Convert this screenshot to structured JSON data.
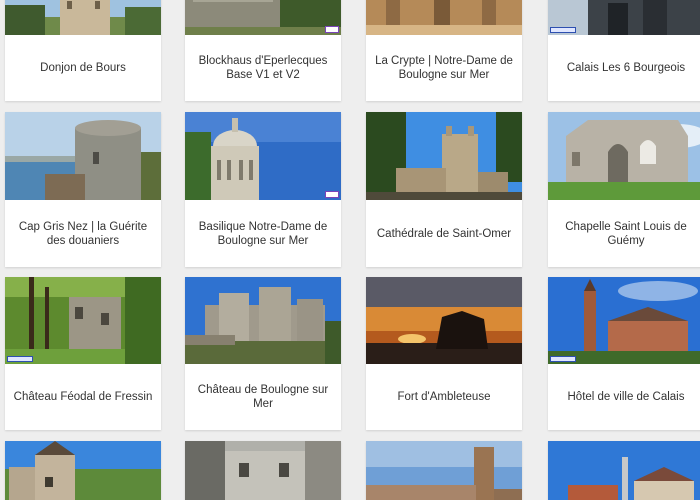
{
  "cards": [
    {
      "title": "Donjon de Bours",
      "image": "castle-keep-photo"
    },
    {
      "title": "Blockhaus d'Eperlecques Base V1 et V2",
      "image": "bunker-photo"
    },
    {
      "title": "La Crypte | Notre-Dame de Boulogne sur Mer",
      "image": "crypt-photo"
    },
    {
      "title": "Calais Les 6 Bourgeois",
      "image": "statue-photo"
    },
    {
      "title": "Cap Gris Nez | la Guérite des douaniers",
      "image": "coastal-tower-photo"
    },
    {
      "title": "Basilique Notre-Dame de Boulogne sur Mer",
      "image": "basilica-dome-photo"
    },
    {
      "title": "Cathédrale de Saint-Omer",
      "image": "cathedral-photo"
    },
    {
      "title": "Chapelle Saint Louis de Guémy",
      "image": "chapel-ruin-photo"
    },
    {
      "title": "Château Féodal de Fressin",
      "image": "castle-ruin-forest-photo"
    },
    {
      "title": "Château de Boulogne sur Mer",
      "image": "fortress-photo"
    },
    {
      "title": "Fort d'Ambleteuse",
      "image": "sea-fort-sunset-photo"
    },
    {
      "title": "Hôtel de ville de Calais",
      "image": "town-hall-belfry-photo"
    },
    {
      "title": "",
      "image": "castle-towers-photo"
    },
    {
      "title": "",
      "image": "chateau-facade-photo"
    },
    {
      "title": "",
      "image": "town-belfry-photo"
    },
    {
      "title": "",
      "image": "seaside-villas-photo"
    }
  ]
}
